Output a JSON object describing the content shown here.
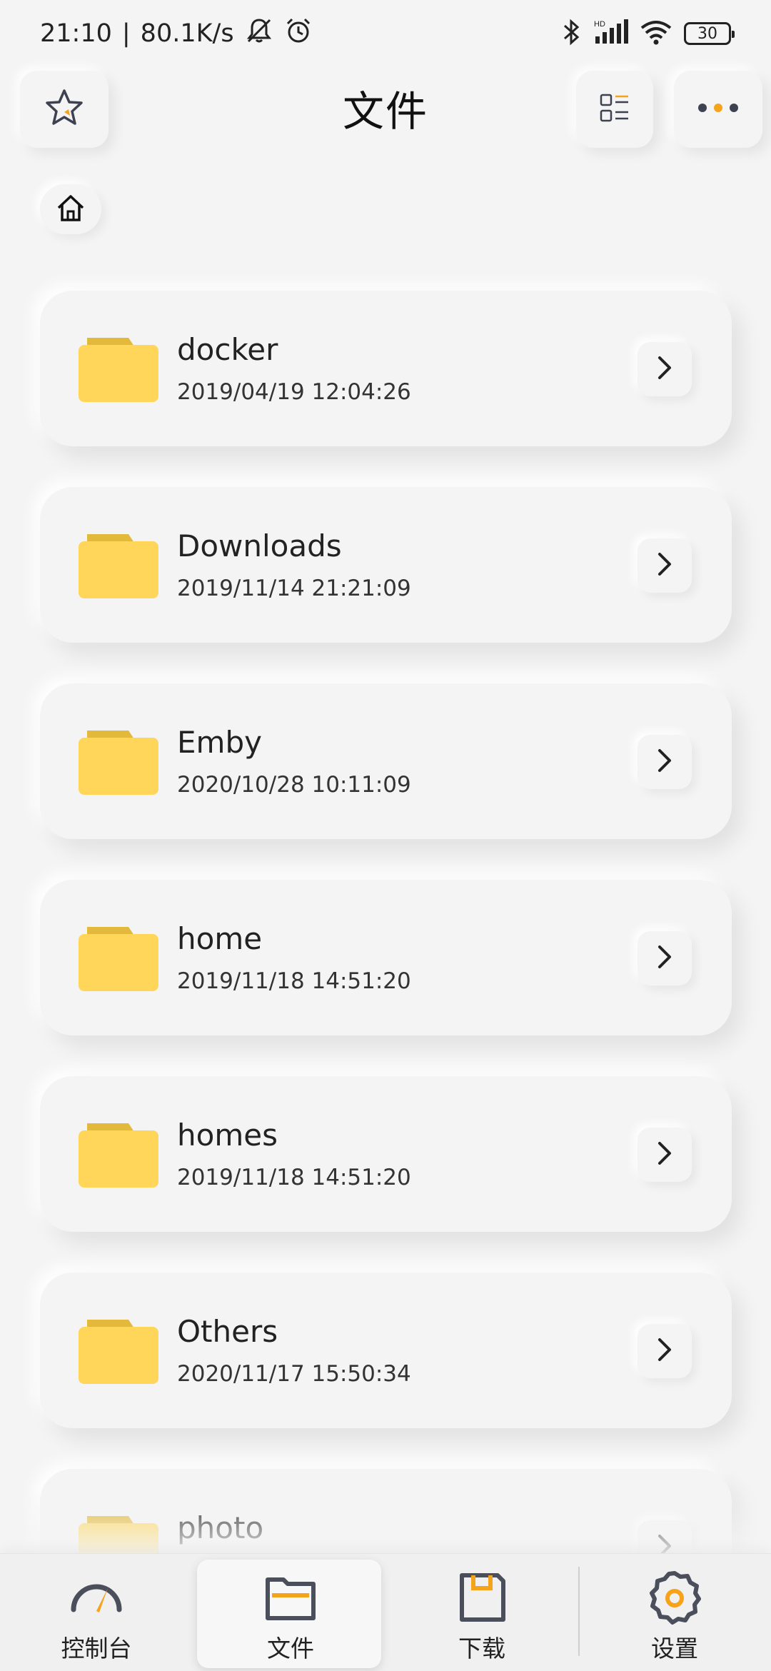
{
  "status_bar": {
    "time": "21:10",
    "separator": "|",
    "net_speed": "80.1K/s",
    "battery": "30"
  },
  "header": {
    "title": "文件"
  },
  "folders": [
    {
      "name": "docker",
      "date": "2019/04/19 12:04:26"
    },
    {
      "name": "Downloads",
      "date": "2019/11/14 21:21:09"
    },
    {
      "name": "Emby",
      "date": "2020/10/28 10:11:09"
    },
    {
      "name": "home",
      "date": "2019/11/18 14:51:20"
    },
    {
      "name": "homes",
      "date": "2019/11/18 14:51:20"
    },
    {
      "name": "Others",
      "date": "2020/11/17 15:50:34"
    },
    {
      "name": "photo",
      "date": ""
    }
  ],
  "bottom_nav": [
    {
      "label": "控制台",
      "icon": "gauge-icon",
      "active": false
    },
    {
      "label": "文件",
      "icon": "folder-icon",
      "active": true
    },
    {
      "label": "下载",
      "icon": "download-file-icon",
      "active": false
    },
    {
      "label": "设置",
      "icon": "gear-icon",
      "active": false
    }
  ],
  "colors": {
    "background": "#f4f4f4",
    "accent": "#f5a31a",
    "folder": "#ffd65a",
    "folder_tab": "#e3b93b",
    "icon_dark": "#4b4f5c"
  }
}
